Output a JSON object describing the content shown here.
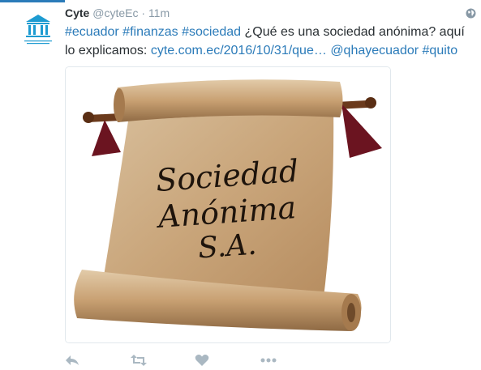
{
  "tweet": {
    "author_name": "Cyte",
    "handle": "@cyteEc",
    "separator": "·",
    "time": "11m",
    "text_segments": [
      {
        "text": "#ecuador",
        "link": true
      },
      {
        "text": " ",
        "link": false
      },
      {
        "text": "#finanzas",
        "link": true
      },
      {
        "text": " ",
        "link": false
      },
      {
        "text": "#sociedad",
        "link": true
      },
      {
        "text": "  ¿Qué es una sociedad anónima? aquí lo explicamos: ",
        "link": false
      },
      {
        "text": "cyte.com.ec/2016/10/31/que…",
        "link": true
      },
      {
        "text": " ",
        "link": false
      },
      {
        "text": "@qhayecuador",
        "link": true
      },
      {
        "text": " ",
        "link": false
      },
      {
        "text": "#quito",
        "link": true
      }
    ],
    "image_text": {
      "line1": "Sociedad",
      "line2": "Anónima",
      "line3": "S.A."
    },
    "actions": [
      {
        "name": "reply-icon"
      },
      {
        "name": "retweet-icon"
      },
      {
        "name": "like-icon"
      },
      {
        "name": "more-icon"
      }
    ]
  },
  "colors": {
    "link": "#2b7bb9",
    "text": "#292f33",
    "muted": "#8899a6",
    "action": "#aab8c2",
    "avatar": "#1d9bd1"
  }
}
